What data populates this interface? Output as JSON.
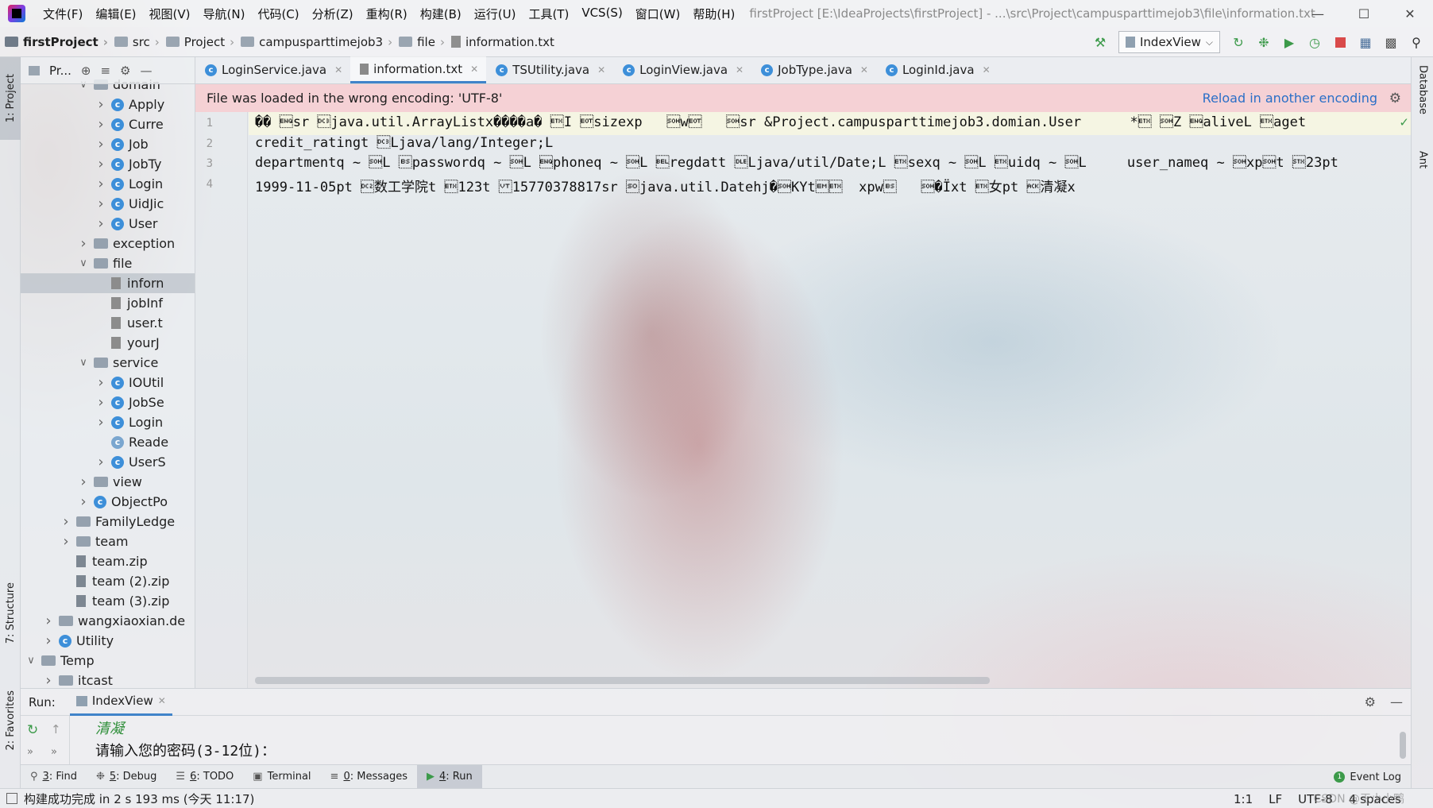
{
  "menu": {
    "items": [
      "文件(F)",
      "编辑(E)",
      "视图(V)",
      "导航(N)",
      "代码(C)",
      "分析(Z)",
      "重构(R)",
      "构建(B)",
      "运行(U)",
      "工具(T)",
      "VCS(S)",
      "窗口(W)",
      "帮助(H)"
    ],
    "title": "firstProject [E:\\IdeaProjects\\firstProject] - ...\\src\\Project\\campusparttimejob3\\file\\information.txt"
  },
  "breadcrumb": [
    "firstProject",
    "src",
    "Project",
    "campusparttimejob3",
    "file",
    "information.txt"
  ],
  "run_config": "IndexView",
  "left_tabs": {
    "project": "1: Project",
    "structure": "7: Structure",
    "favorites": "2: Favorites"
  },
  "right_tabs": {
    "database": "Database",
    "ant": "Ant"
  },
  "project_panel": {
    "title": "Pr..."
  },
  "tree": [
    {
      "label": "domain",
      "indent": 4,
      "type": "folder-open"
    },
    {
      "label": "Apply",
      "indent": 5,
      "type": "class"
    },
    {
      "label": "Curre",
      "indent": 5,
      "type": "class"
    },
    {
      "label": "Job",
      "indent": 5,
      "type": "class"
    },
    {
      "label": "JobTy",
      "indent": 5,
      "type": "class"
    },
    {
      "label": "Login",
      "indent": 5,
      "type": "class"
    },
    {
      "label": "UidJic",
      "indent": 5,
      "type": "class"
    },
    {
      "label": "User",
      "indent": 5,
      "type": "class"
    },
    {
      "label": "exception",
      "indent": 4,
      "type": "folder"
    },
    {
      "label": "file",
      "indent": 4,
      "type": "folder-open"
    },
    {
      "label": "inforn",
      "indent": 5,
      "type": "file",
      "selected": true
    },
    {
      "label": "jobInf",
      "indent": 5,
      "type": "file"
    },
    {
      "label": "user.t",
      "indent": 5,
      "type": "file"
    },
    {
      "label": "yourJ",
      "indent": 5,
      "type": "file"
    },
    {
      "label": "service",
      "indent": 4,
      "type": "folder-open"
    },
    {
      "label": "IOUtil",
      "indent": 5,
      "type": "class"
    },
    {
      "label": "JobSe",
      "indent": 5,
      "type": "class"
    },
    {
      "label": "Login",
      "indent": 5,
      "type": "class"
    },
    {
      "label": "Reade",
      "indent": 5,
      "type": "class-plain"
    },
    {
      "label": "UserS",
      "indent": 5,
      "type": "class"
    },
    {
      "label": "view",
      "indent": 4,
      "type": "folder"
    },
    {
      "label": "ObjectPo",
      "indent": 4,
      "type": "class"
    },
    {
      "label": "FamilyLedge",
      "indent": 3,
      "type": "folder"
    },
    {
      "label": "team",
      "indent": 3,
      "type": "folder"
    },
    {
      "label": "team.zip",
      "indent": 3,
      "type": "zip"
    },
    {
      "label": "team (2).zip",
      "indent": 3,
      "type": "zip"
    },
    {
      "label": "team (3).zip",
      "indent": 3,
      "type": "zip"
    },
    {
      "label": "wangxiaoxian.de",
      "indent": 2,
      "type": "folder"
    },
    {
      "label": "Utility",
      "indent": 2,
      "type": "class"
    },
    {
      "label": "Temp",
      "indent": 1,
      "type": "folder-open"
    },
    {
      "label": "itcast",
      "indent": 2,
      "type": "folder"
    }
  ],
  "tabs": [
    {
      "label": "LoginService.java",
      "icon": "class"
    },
    {
      "label": "information.txt",
      "icon": "file",
      "active": true
    },
    {
      "label": "TSUtility.java",
      "icon": "class"
    },
    {
      "label": "LoginView.java",
      "icon": "class"
    },
    {
      "label": "JobType.java",
      "icon": "class"
    },
    {
      "label": "LoginId.java",
      "icon": "class"
    }
  ],
  "banner": {
    "message": "File was loaded in the wrong encoding: 'UTF-8'",
    "reload": "Reload in another encoding"
  },
  "line_numbers": [
    "1",
    "2",
    "3",
    "4"
  ],
  "code_lines": [
    "�� \u0005sr \u0013java.util.ArrayListx����a� \u0003I \u0004sizexp   \u0001w\u0004   \u0001sr &Project.campusparttimejob3.domian.User      *\u0003 \u0001Z \u0005aliveL \u0003aget",
    "credit_ratingt \u0013Ljava/lang/Integer;L",
    "departmentq ~ \u0001L \bpasswordq ~ \u0001L \u0005phoneq ~ \u0001L \u0007regdatt \u0010Ljava/util/Date;L \u0003sexq ~ \u0001L \u0003uidq ~ \u0001L     user_nameq ~ \u0001xp\u0001t \u000223pt",
    "1999-11-05pt \u0012数工学院t \u0003123t \u000b15770378817sr \u000ejava.util.Datehj�\u0001KYt\u0019\u0003  xpw\b   \u0001�Ïxt \u0003女pt \u0006清凝x"
  ],
  "run": {
    "label": "Run:",
    "tab": "IndexView",
    "output_1": "清凝",
    "output_2": "请输入您的密码(3-12位)："
  },
  "bottom_tabs": [
    {
      "key": "3",
      "rest": ": Find",
      "icon": "search-icon"
    },
    {
      "key": "5",
      "rest": ": Debug",
      "icon": "bug-icon"
    },
    {
      "key": "6",
      "rest": ": TODO",
      "icon": "list-icon"
    },
    {
      "key": "",
      "rest": "Terminal",
      "icon": "terminal-icon"
    },
    {
      "key": "0",
      "rest": ": Messages",
      "icon": "messages-icon"
    },
    {
      "key": "4",
      "rest": ": Run",
      "icon": "play-icon",
      "active": true
    }
  ],
  "event_log": "Event Log",
  "status": {
    "message": "构建成功完成 in 2 s 193 ms (今天 11:17)",
    "position": "1:1",
    "line_sep": "LF",
    "encoding": "UTF-8",
    "indent": "4 spaces",
    "watermark": "CSDN @王小小鸭"
  }
}
